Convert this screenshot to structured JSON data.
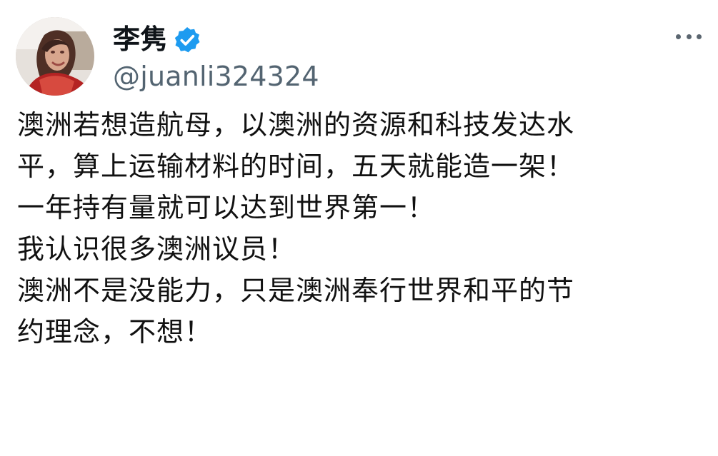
{
  "post": {
    "author": {
      "display_name": "李隽",
      "handle": "@juanli324324",
      "verified": true,
      "verified_color": "#1d9bf0"
    },
    "menu_icon": "more-dots-icon",
    "lines": [
      "澳洲若想造航母，以澳洲的资源和科技发达水",
      "平，算上运输材料的时间，五天就能造一架！",
      "一年持有量就可以达到世界第一！",
      "我认识很多澳洲议员！",
      "澳洲不是没能力，只是澳洲奉行世界和平的节",
      "约理念，不想！"
    ]
  }
}
